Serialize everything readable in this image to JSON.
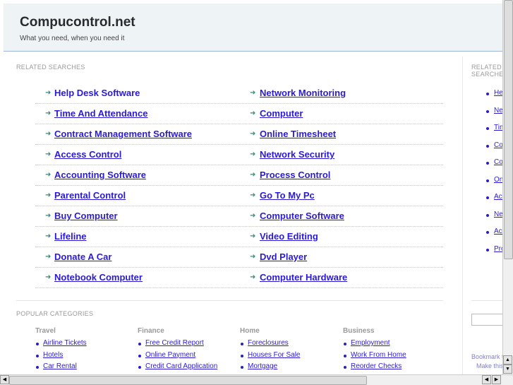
{
  "header": {
    "title": "Compucontrol.net",
    "tagline": "What you need, when you need it"
  },
  "related": {
    "heading": "RELATED SEARCHES",
    "left": [
      "Help Desk Software",
      "Time And Attendance",
      "Contract Management Software",
      "Access Control",
      "Accounting Software",
      "Parental Control",
      "Buy Computer",
      "Lifeline",
      "Donate A Car",
      "Notebook Computer"
    ],
    "right": [
      "Network Monitoring",
      "Computer",
      "Online Timesheet",
      "Network Security",
      "Process Control",
      "Go To My Pc",
      "Computer Software",
      "Video Editing",
      "Dvd Player",
      "Computer Hardware"
    ]
  },
  "popular": {
    "heading": "POPULAR CATEGORIES",
    "categories": [
      {
        "name": "Travel",
        "links": [
          "Airline Tickets",
          "Hotels",
          "Car Rental"
        ]
      },
      {
        "name": "Finance",
        "links": [
          "Free Credit Report",
          "Online Payment",
          "Credit Card Application"
        ]
      },
      {
        "name": "Home",
        "links": [
          "Foreclosures",
          "Houses For Sale",
          "Mortgage"
        ]
      },
      {
        "name": "Business",
        "links": [
          "Employment",
          "Work From Home",
          "Reorder Checks"
        ]
      }
    ]
  },
  "sidebar": {
    "heading": "RELATED SEARCHES",
    "links": [
      "Help Desk Software",
      "Network Monitoring",
      "Time And Attendance",
      "Computer",
      "Contract Management Software",
      "Online Timesheet",
      "Access Control",
      "Network Security",
      "Accounting Software",
      "Process Control"
    ],
    "bookmark": "Bookmark this page",
    "homepage": "Make this your homepage"
  }
}
